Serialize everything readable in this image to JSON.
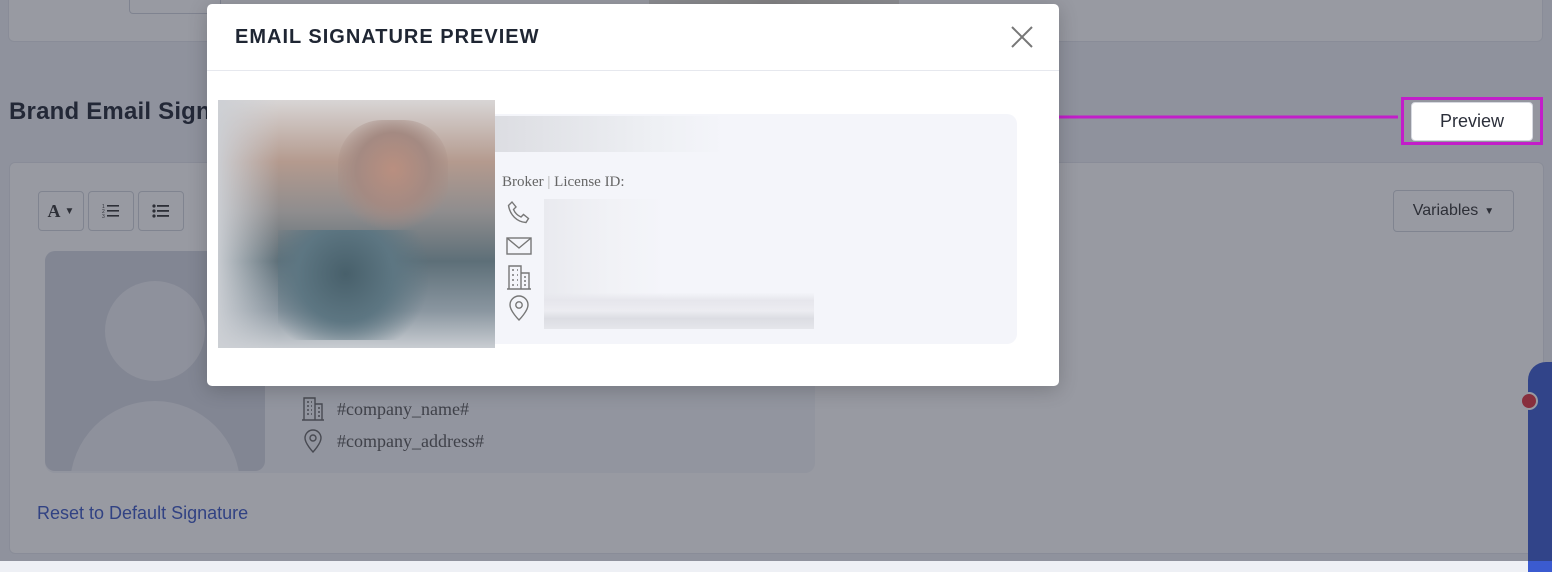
{
  "section": {
    "title": "Brand Email Signature",
    "preview_label": "Preview",
    "variables_label": "Variables",
    "reset_label": "Reset to Default Signature",
    "toolbar_font_label": "A"
  },
  "signature_template": {
    "company_name": "#company_name#",
    "company_address": "#company_address#"
  },
  "modal": {
    "title": "EMAIL SIGNATURE PREVIEW",
    "role_prefix": "Broker",
    "separator": "|",
    "license_label": "License ID:"
  },
  "icons": [
    "text-format-icon",
    "ordered-list-icon",
    "unordered-list-icon",
    "phone-icon",
    "email-icon",
    "building-icon",
    "location-pin-icon",
    "close-icon",
    "caret-down-icon"
  ],
  "colors": {
    "highlight": "#c21ec9",
    "link": "#3a57c4",
    "widget": "#3b5bd0"
  }
}
